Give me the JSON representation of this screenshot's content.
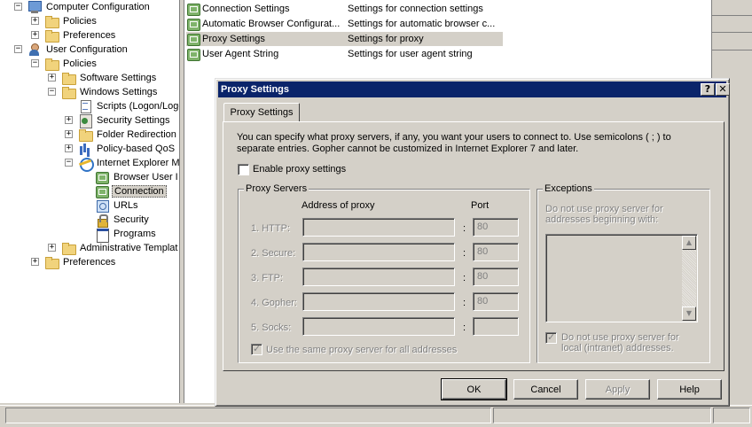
{
  "tree": {
    "items": [
      {
        "label": "Computer Configuration",
        "icon": "computer-icon",
        "expander": "−"
      },
      {
        "label": "Policies",
        "icon": "folder-icon",
        "expander": "+"
      },
      {
        "label": "Preferences",
        "icon": "folder-icon",
        "expander": "+"
      },
      {
        "label": "User Configuration",
        "icon": "user-icon",
        "expander": "−"
      },
      {
        "label": "Policies",
        "icon": "folder-icon",
        "expander": "−"
      },
      {
        "label": "Software Settings",
        "icon": "folder-icon",
        "expander": "+"
      },
      {
        "label": "Windows Settings",
        "icon": "folder-icon",
        "expander": "−"
      },
      {
        "label": "Scripts (Logon/Logo",
        "icon": "script-icon",
        "expander": ""
      },
      {
        "label": "Security Settings",
        "icon": "security-settings-icon",
        "expander": "+"
      },
      {
        "label": "Folder Redirection",
        "icon": "folder-icon",
        "expander": "+"
      },
      {
        "label": "Policy-based QoS",
        "icon": "chart-icon",
        "expander": "+"
      },
      {
        "label": "Internet Explorer M",
        "icon": "ie-icon",
        "expander": "−"
      },
      {
        "label": "Browser User I",
        "icon": "connection-icon",
        "expander": ""
      },
      {
        "label": "Connection",
        "icon": "connection-icon",
        "expander": ""
      },
      {
        "label": "URLs",
        "icon": "url-icon",
        "expander": ""
      },
      {
        "label": "Security",
        "icon": "lock-icon",
        "expander": ""
      },
      {
        "label": "Programs",
        "icon": "programs-icon",
        "expander": ""
      },
      {
        "label": "Administrative Templat",
        "icon": "folder-icon",
        "expander": "+"
      },
      {
        "label": "Preferences",
        "icon": "folder-icon",
        "expander": "+"
      }
    ]
  },
  "list": {
    "rows": [
      {
        "name": "Connection Settings",
        "desc": "Settings for connection settings"
      },
      {
        "name": "Automatic Browser Configurat...",
        "desc": "Settings for automatic browser c..."
      },
      {
        "name": "Proxy Settings",
        "desc": "Settings for proxy"
      },
      {
        "name": "User Agent String",
        "desc": "Settings for user agent string"
      }
    ]
  },
  "dialog": {
    "title": "Proxy Settings",
    "help_glyph": "?",
    "close_glyph": "✕",
    "tab_label": "Proxy Settings",
    "intro_line1": "You can specify what proxy servers, if any, you want your users to connect to. Use semicolons ( ; ) to",
    "intro_line2": "separate entries. Gopher cannot be customized in Internet Explorer 7 and later.",
    "enable_label": "Enable proxy settings",
    "proxy_servers": {
      "title": "Proxy Servers",
      "address_header": "Address of proxy",
      "port_header": "Port",
      "rows": [
        {
          "label": "1. HTTP:",
          "address": "",
          "port": "80"
        },
        {
          "label": "2. Secure:",
          "address": "",
          "port": "80"
        },
        {
          "label": "3. FTP:",
          "address": "",
          "port": "80"
        },
        {
          "label": "4. Gopher:",
          "address": "",
          "port": "80"
        },
        {
          "label": "5. Socks:",
          "address": "",
          "port": ""
        }
      ],
      "same_proxy_label": "Use the same proxy server for all addresses"
    },
    "exceptions": {
      "title": "Exceptions",
      "hint_line1": "Do not use proxy server for",
      "hint_line2": "addresses beginning with:",
      "local_line1": "Do not use proxy server for",
      "local_line2": "local (intranet) addresses."
    },
    "buttons": {
      "ok": "OK",
      "cancel": "Cancel",
      "apply": "Apply",
      "help": "Help"
    }
  }
}
